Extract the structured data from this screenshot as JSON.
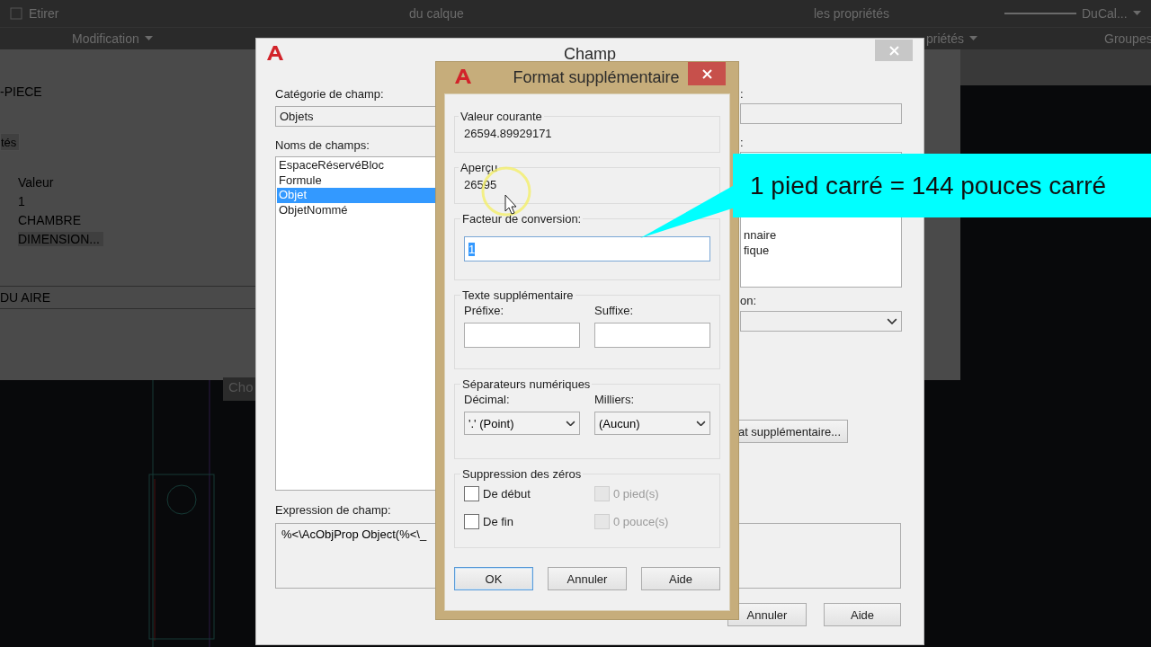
{
  "ribbon": {
    "tools": [
      {
        "label": "Etirer"
      },
      {
        "label": "du calque"
      },
      {
        "label": "les propriétés"
      }
    ],
    "linetype": "DuCal...",
    "panels": [
      {
        "label": "Modification"
      },
      {
        "label": "priétés"
      },
      {
        "label": "Groupes"
      }
    ]
  },
  "palette": {
    "title": "-PIECE",
    "tab": "tés",
    "column": "Valeur",
    "rows": [
      "1",
      "CHAMBRE",
      "DIMENSION..."
    ],
    "footer": "DU AIRE"
  },
  "tooltip": "Cho",
  "champ": {
    "title": "Champ",
    "category_label": "Catégorie de champ:",
    "category": "Objets",
    "names_label": "Noms de champs:",
    "names": [
      {
        "label": "EspaceRéservéBloc",
        "selected": false
      },
      {
        "label": "Formule",
        "selected": false
      },
      {
        "label": "Objet",
        "selected": true
      },
      {
        "label": "ObjetNommé",
        "selected": false
      }
    ],
    "expression_label": "Expression de champ:",
    "expression": "%<\\AcObjProp Object(%<\\_",
    "right_labels": [
      ":",
      ":",
      "on:"
    ],
    "formats": [
      "nnaire",
      "fique"
    ],
    "more_button": "at supplémentaire...",
    "buttons": [
      "Annuler",
      "Aide"
    ]
  },
  "format": {
    "title": "Format supplémentaire",
    "current_label": "Valeur courante",
    "current": "26594.89929171",
    "preview_label": "Aperçu",
    "preview": "26595",
    "factor_label": "Facteur de conversion:",
    "factor": "1",
    "extra_label": "Texte supplémentaire",
    "prefix_label": "Préfixe:",
    "suffix_label": "Suffixe:",
    "separators_label": "Séparateurs numériques",
    "decimal_label": "Décimal:",
    "decimal": "'.' (Point)",
    "thousands_label": "Milliers:",
    "thousands": "(Aucun)",
    "zeros_label": "Suppression des zéros",
    "zeros": [
      {
        "label": "De début",
        "checked": false,
        "disabled": false
      },
      {
        "label": "0 pied(s)",
        "checked": false,
        "disabled": true
      },
      {
        "label": "De fin",
        "checked": false,
        "disabled": false
      },
      {
        "label": "0 pouce(s)",
        "checked": false,
        "disabled": true
      }
    ],
    "buttons": [
      {
        "label": "OK",
        "focused": true
      },
      {
        "label": "Annuler",
        "focused": false
      },
      {
        "label": "Aide",
        "focused": false
      }
    ]
  },
  "callout": "1 pied carré = 144 pouces carré"
}
